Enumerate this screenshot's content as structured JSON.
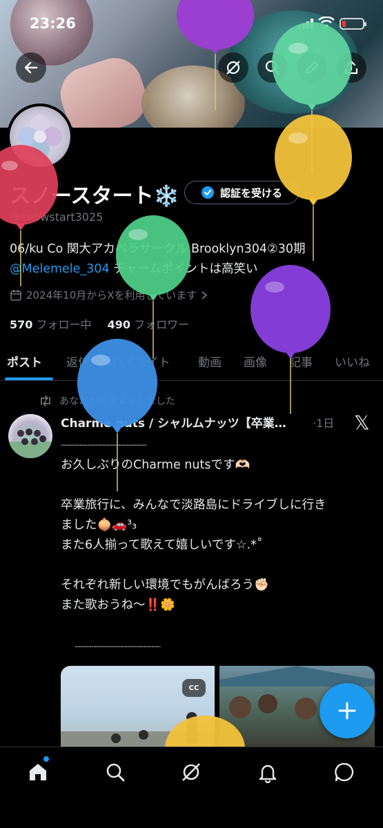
{
  "status_bar": {
    "time": "23:26"
  },
  "profile": {
    "name": "スノースタート❄️",
    "handle": "@snowstart3025",
    "verify_button": "認証を受ける",
    "bio_line1": "06/ku Co 関大アカペラサークル Brooklyn304②30期",
    "bio_mention": "@Melemele_304",
    "bio_line2_rest": " チャームポイントは高笑い",
    "joined": "2024年10月からXを利用しています",
    "following_count": "570",
    "following_label": " フォロー中",
    "followers_count": "490",
    "followers_label": " フォロワー"
  },
  "tabs": [
    {
      "label": "ポスト",
      "active": true
    },
    {
      "label": "返信"
    },
    {
      "label": "ハイライト"
    },
    {
      "label": "動画"
    },
    {
      "label": "画像"
    },
    {
      "label": "記事"
    },
    {
      "label": "いいね"
    }
  ],
  "post": {
    "repost_label": "あなたがリポストしました",
    "author": "Charme nuts / シャルムナッツ【卒業…",
    "time": "·1日",
    "separator": "┈┈┈┈┈┈┈┈┈┈┈┈┈┈┈┈┈┈┈┈┈┈",
    "lines": [
      "お久しぶりのCharme nutsです🫶🏻",
      "",
      "卒業旅行に、みんなで淡路島にドライブしに行き",
      "ました🧅🚗³₃",
      "また6人揃って歌えて嬉しいです☆.*˚",
      "",
      "それぞれ新しい環境でもがんばろう✊🏻",
      "また歌おうね〜‼️🌼"
    ],
    "separator_bottom": "┈┈┈┈┈┈┈┈┈┈┈┈┈┈┈┈┈┈┈┈┈┈",
    "media_badge": "CC"
  },
  "colors": {
    "accent": "#1d9bf0",
    "background": "#000000",
    "secondary_text": "#71767b",
    "balloons": [
      "#e0405a",
      "#4fd18a",
      "#9b3fd0",
      "#3d8fe6",
      "#f2c23a",
      "#8a3fe0",
      "#5fd6a0",
      "#f2c23a"
    ]
  },
  "icons": {
    "back": "arrow-left-icon",
    "grok": "grok-icon",
    "search": "search-icon",
    "edit": "pencil-icon",
    "share": "share-icon",
    "calendar": "calendar-icon",
    "repost": "repost-icon",
    "compose": "plus-icon",
    "nav": [
      "home-icon",
      "search-icon",
      "grok-icon",
      "bell-icon",
      "message-icon"
    ]
  }
}
